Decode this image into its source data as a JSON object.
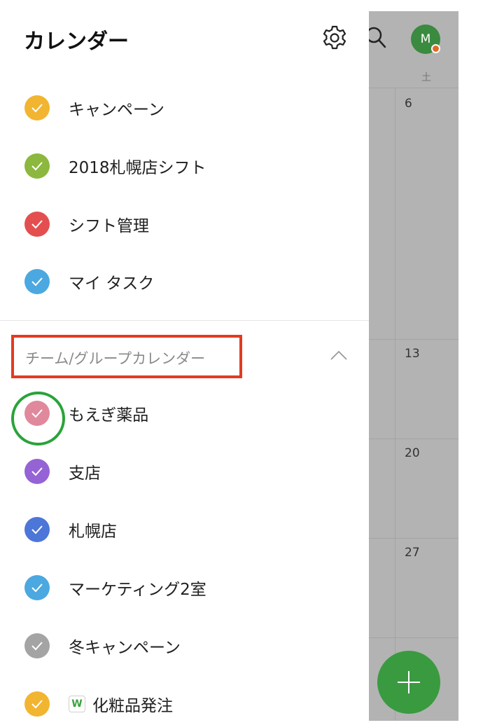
{
  "drawer": {
    "title": "カレンダー",
    "my_calendars": [
      {
        "label": "キャンペーン",
        "color": "#F2B531"
      },
      {
        "label": "2018札幌店シフト",
        "color": "#8CB83E"
      },
      {
        "label": "シフト管理",
        "color": "#E34F4F"
      },
      {
        "label": "マイ タスク",
        "color": "#4BA8E0"
      }
    ],
    "section": {
      "label": "チーム/グループカレンダー",
      "items": [
        {
          "label": "もえぎ薬品",
          "color": "#E0899C"
        },
        {
          "label": "支店",
          "color": "#9563D5"
        },
        {
          "label": "札幌店",
          "color": "#4C76D8"
        },
        {
          "label": "マーケティング2室",
          "color": "#4BA8E0"
        },
        {
          "label": "冬キャンペーン",
          "color": "#A4A4A4"
        },
        {
          "label": "化粧品発注",
          "color": "#F2B531",
          "badge": "W"
        }
      ]
    },
    "annotation_colors": {
      "red_box": "#E23B22",
      "green_circle": "#2AA33A"
    }
  },
  "calendar": {
    "weekday_label": "土",
    "day_numbers": [
      "6",
      "13",
      "20",
      "27"
    ],
    "avatar_initial": "M",
    "accent": "#3A9A40"
  }
}
